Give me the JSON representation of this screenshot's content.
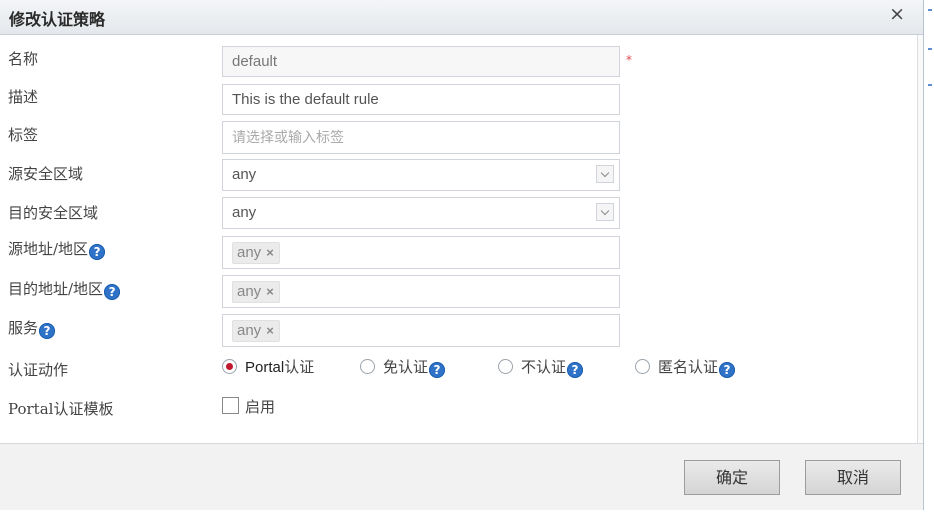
{
  "dialog": {
    "title": "修改认证策略",
    "close_label": "×"
  },
  "form": {
    "name": {
      "label": "名称",
      "value": "default",
      "required_mark": "*"
    },
    "description": {
      "label": "描述",
      "value": "This is the default rule"
    },
    "tags": {
      "label": "标签",
      "placeholder": "请选择或输入标签"
    },
    "src_zone": {
      "label": "源安全区域",
      "value": "any"
    },
    "dst_zone": {
      "label": "目的安全区域",
      "value": "any"
    },
    "src_addr": {
      "label": "源地址/地区",
      "tag": "any",
      "tag_remove": "×"
    },
    "dst_addr": {
      "label": "目的地址/地区",
      "tag": "any",
      "tag_remove": "×"
    },
    "service": {
      "label": "服务",
      "tag": "any",
      "tag_remove": "×"
    },
    "auth_action": {
      "label": "认证动作",
      "options": [
        {
          "prefix": "Portal",
          "label": "认证",
          "checked": true,
          "help": false
        },
        {
          "prefix": "",
          "label": "免认证",
          "checked": false,
          "help": true
        },
        {
          "prefix": "",
          "label": "不认证",
          "checked": false,
          "help": true
        },
        {
          "prefix": "",
          "label": "匿名认证",
          "checked": false,
          "help": true
        }
      ]
    },
    "portal_template": {
      "label_prefix": "Portal",
      "label": "认证模板",
      "checkbox_label": "启用",
      "enabled": false
    }
  },
  "help_icon": "?",
  "buttons": {
    "ok": "确定",
    "cancel": "取消"
  },
  "colors": {
    "accent_blue": "#2f73c9",
    "radio_red": "#c0182d",
    "required_red": "#e24a4a"
  }
}
